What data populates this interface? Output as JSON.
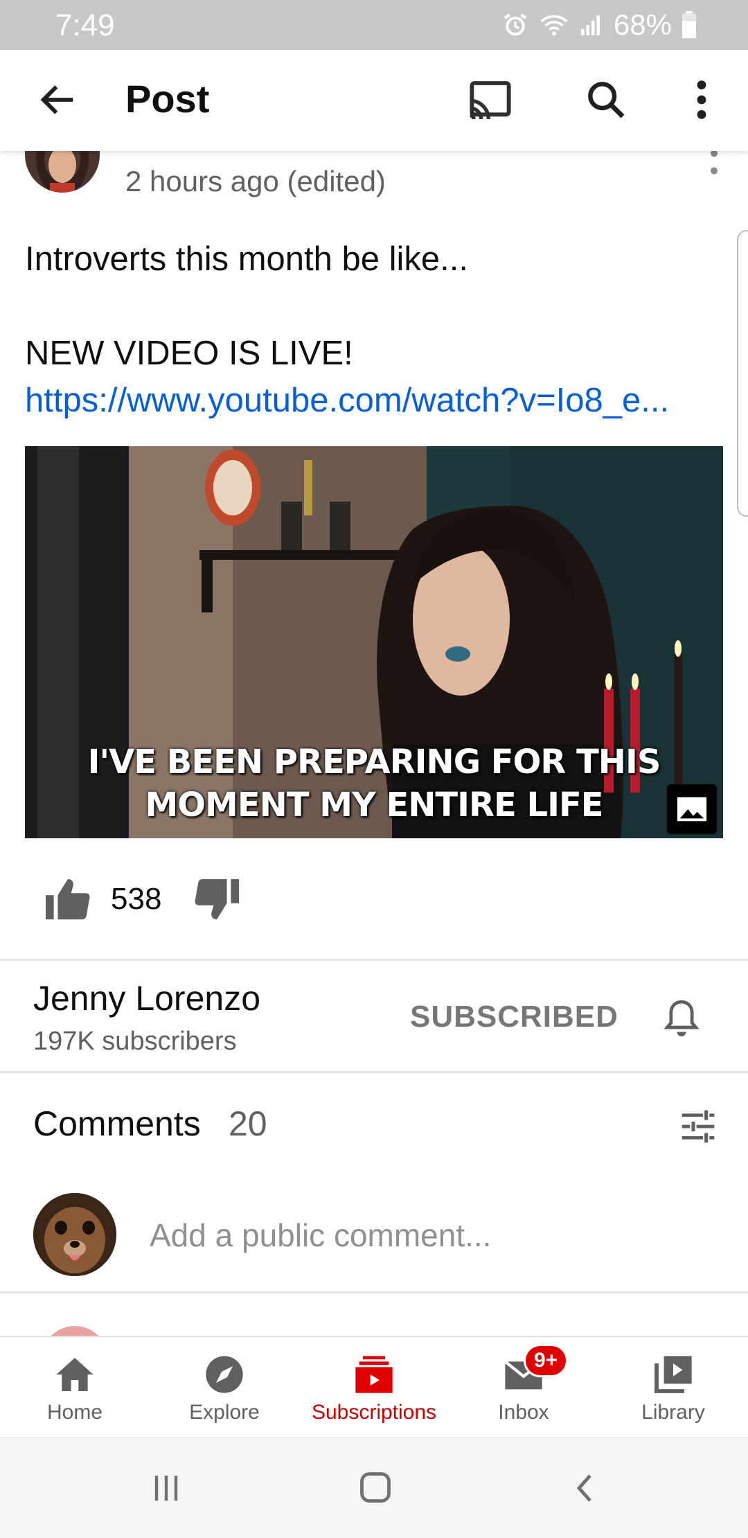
{
  "status_bar": {
    "time": "7:49",
    "battery": "68%"
  },
  "app_bar": {
    "title": "Post"
  },
  "post": {
    "time": "2 hours ago (edited)",
    "text_line1": "Introverts this month be like...",
    "text_line2_prefix": "NEW VIDEO IS LIVE! ",
    "link": "https://www.youtube.com/watch?v=Io8_e...",
    "image_caption_line1": "I'VE BEEN PREPARING FOR THIS",
    "image_caption_line2": "MOMENT MY ENTIRE LIFE",
    "like_count": "538"
  },
  "channel": {
    "name": "Jenny Lorenzo",
    "subscribers": "197K subscribers",
    "subscribe_label": "SUBSCRIBED"
  },
  "comments": {
    "label": "Comments",
    "count": "20",
    "placeholder": "Add a public comment..."
  },
  "bottom_nav": {
    "items": [
      {
        "label": "Home",
        "icon": "home-icon"
      },
      {
        "label": "Explore",
        "icon": "compass-icon"
      },
      {
        "label": "Subscriptions",
        "icon": "subscriptions-icon",
        "active": true
      },
      {
        "label": "Inbox",
        "icon": "mail-icon",
        "badge": "9+"
      },
      {
        "label": "Library",
        "icon": "library-icon"
      }
    ]
  },
  "colors": {
    "accent": "#cc0000",
    "link": "#065fd4",
    "badge": "#e00000"
  }
}
